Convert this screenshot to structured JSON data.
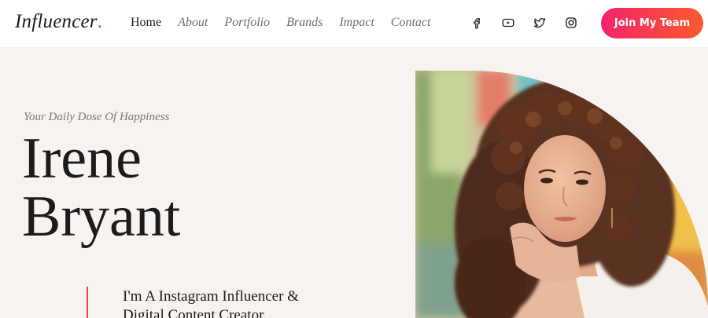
{
  "brand": {
    "name": "Influencer",
    "dot": "."
  },
  "nav": [
    {
      "label": "Home",
      "active": true
    },
    {
      "label": "About"
    },
    {
      "label": "Portfolio"
    },
    {
      "label": "Brands"
    },
    {
      "label": "Impact"
    },
    {
      "label": "Contact"
    }
  ],
  "socials": [
    "facebook-icon",
    "youtube-icon",
    "twitter-icon",
    "instagram-icon"
  ],
  "cta": {
    "label": "Join My Team"
  },
  "hero": {
    "tagline": "Your Daily Dose Of Happiness",
    "name_line1": "Irene",
    "name_line2": "Bryant",
    "bio_line1": "I'm A Instagram Influencer &",
    "bio_line2": "Digital Content Creator."
  },
  "colors": {
    "background": "#f7f3f0",
    "header": "#ffffff",
    "accent": "#ef3b3b",
    "cta_start": "#f5246a",
    "cta_end": "#fb5a2e"
  }
}
